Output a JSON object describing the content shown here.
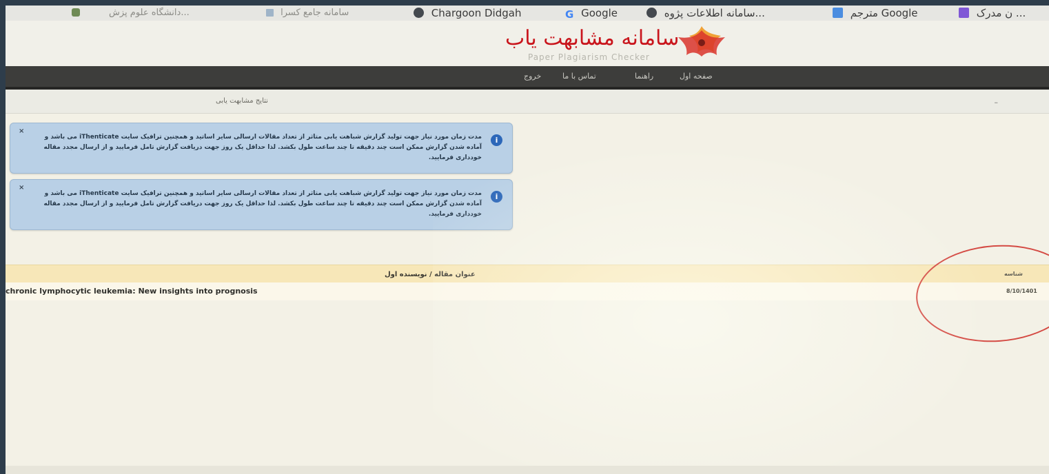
{
  "bookmarks": [
    {
      "label": "...",
      "icon": "extension-icon",
      "dim": true
    },
    {
      "label": "دانشگاه علوم پزش...",
      "icon": "bookmark-icon",
      "dim": true
    },
    {
      "label": "سامانه جامع کسرا",
      "icon": "bookmark-icon",
      "dim": true
    },
    {
      "label": "Chargoon Didgah",
      "icon": "globe-icon",
      "dim": false
    },
    {
      "label": "Google",
      "icon": "google-icon",
      "dim": false
    },
    {
      "label": "سامانه اطلاعات پژوه...",
      "icon": "globe-icon",
      "dim": false
    },
    {
      "label": "مترجم Google",
      "icon": "translate-icon",
      "dim": false
    },
    {
      "label": "ن مدرک ...",
      "icon": "d-icon",
      "dim": false
    }
  ],
  "site": {
    "title": "سامانه مشابهت یاب",
    "subtitle": "Paper Plagiarism Checker"
  },
  "nav": {
    "items": [
      "صفحه اول",
      "راهنما",
      "تماس با ما",
      "خروج"
    ]
  },
  "page": {
    "heading": "نتایج مشابهت یابی"
  },
  "alerts": [
    {
      "text": "مدت زمان مورد نیاز جهت تولید گزارش شباهت یابی متاثر از تعداد مقالات ارسالی سایر اساتید و همچنین ترافیک سایت iThenticate می باشد و آماده شدن گزارش ممکن است چند دقیقه تا چند ساعت طول بکشد. لذا حداقل یک روز جهت دریافت گزارش تامل فرمایید و از ارسال مجدد مقاله خودداری فرمایید.",
      "close": "×"
    },
    {
      "text": "مدت زمان مورد نیاز جهت تولید گزارش شباهت یابی متاثر از تعداد مقالات ارسالی سایر اساتید و همچنین ترافیک سایت iThenticate می باشد و آماده شدن گزارش ممکن است چند دقیقه تا چند ساعت طول بکشد. لذا حداقل یک روز جهت دریافت گزارش تامل فرمایید و از ارسال مجدد مقاله خودداری فرمایید.",
      "close": "×"
    }
  ],
  "table": {
    "headers": {
      "title": "عنوان مقاله / نویسنده اول",
      "id": "شناسه"
    },
    "rows": [
      {
        "title": "chronic lymphocytic leukemia: New insights into prognosis",
        "id": "8/10/1401"
      }
    ]
  },
  "colors": {
    "brand": "#c9151c",
    "nav_bg": "#3d3d3b",
    "alert_bg": "#b9d0e6",
    "table_head_bg": "#f7e7b8",
    "annotation": "#d44a43"
  }
}
